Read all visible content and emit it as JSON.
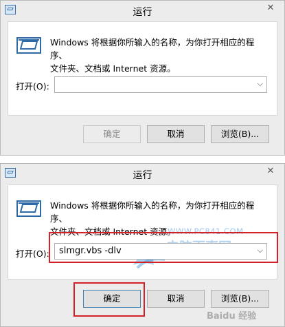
{
  "dialogs": [
    {
      "title": "运行",
      "close_glyph": "✕",
      "description_line1": "Windows 将根据你所输入的名称，为你打开相应的程序、",
      "description_line2": "文件夹、文档或 Internet 资源。",
      "open_label": "打开(O):",
      "open_value": "",
      "ok_label": "确定",
      "cancel_label": "取消",
      "browse_label": "浏览(B)..."
    },
    {
      "title": "运行",
      "close_glyph": "✕",
      "description_line1": "Windows 将根据你所输入的名称，为你打开相应的程序、",
      "description_line2": "文件夹、文档或 Internet 资源。",
      "open_label": "打开(O):",
      "open_value": "slmgr.vbs -dlv",
      "ok_label": "确定",
      "cancel_label": "取消",
      "browse_label": "浏览(B)..."
    }
  ],
  "watermarks": {
    "site_url": "WWW.PC841.COM",
    "site_name": "电脑百事网",
    "corner_text": "Baidu 经验"
  },
  "colors": {
    "highlight": "#d42127",
    "dialog_bg": "#ececec",
    "content_bg": "#ffffff"
  }
}
